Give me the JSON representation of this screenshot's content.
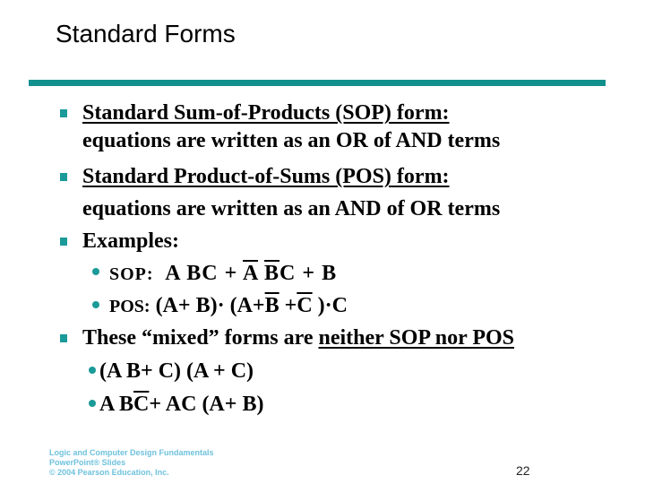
{
  "title": "Standard Forms",
  "bullets": [
    {
      "heading": "Standard Sum-of-Products (SOP) form:",
      "body": "equations are written as an OR of AND terms"
    },
    {
      "heading": "Standard Product-of-Sums (POS) form:",
      "body": "equations are written as an AND of OR terms"
    },
    {
      "heading": "Examples:",
      "sub": [
        {
          "label": "SOP:",
          "expression": "A B C + A̅ B̅ C + B",
          "parts": [
            "A",
            "B",
            "C",
            "+",
            "A",
            "B",
            "C",
            "+",
            "B"
          ]
        },
        {
          "label": "POS:",
          "expression": "(A + B)·(A + B̅ + C̅)·C",
          "parts": [
            "(A",
            "+",
            "B)",
            "·",
            "(A",
            "+",
            "B",
            "+",
            "C",
            ")",
            "·",
            "C"
          ]
        }
      ]
    },
    {
      "text_prefix": "These “mixed” forms are ",
      "text_underlined": "neither SOP nor POS",
      "sub": [
        {
          "expression": "(A B + C) (A + C)",
          "parts": [
            "(A",
            "B",
            "+",
            "C)",
            "(A",
            "+",
            "C)"
          ]
        },
        {
          "expression": "A B C̅ + A C (A + B)",
          "parts": [
            "A",
            "B",
            "C",
            "+",
            "A",
            "C",
            "(A",
            "+",
            "B)"
          ]
        }
      ]
    }
  ],
  "footer": {
    "line1": "Logic and Computer Design Fundamentals",
    "line2": "PowerPoint® Slides",
    "line3": "© 2004 Pearson Education, Inc."
  },
  "page_number": "22",
  "colors": {
    "accent": "#12908e",
    "bullet": "#1a9a98",
    "footer_text": "#6ec2dd"
  }
}
